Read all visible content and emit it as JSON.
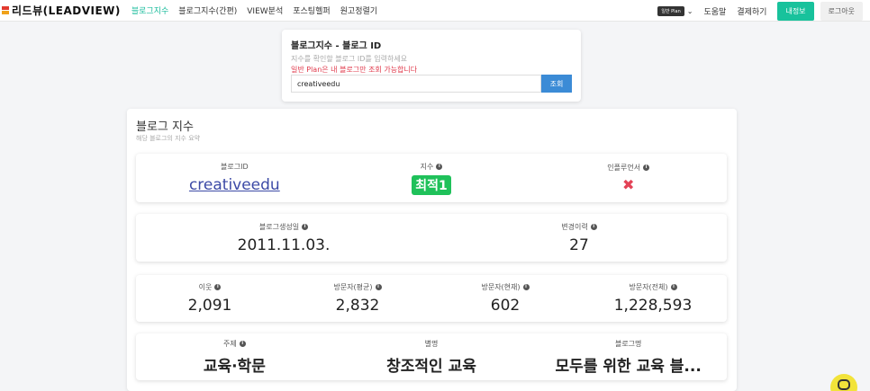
{
  "nav": {
    "logo_text": "리드뷰(LEADVIEW)",
    "items": [
      "블로그지수",
      "블로그지수(간편)",
      "VIEW분석",
      "포스팅헬퍼",
      "원고정렬기"
    ],
    "plan_badge": "일반 Plan",
    "help": "도움말",
    "payment": "결제하기",
    "myinfo": "내정보",
    "logout": "로그아웃"
  },
  "search": {
    "title": "블로그지수 - 블로그 ID",
    "subtitle": "지수를 확인할 블로그 ID를 입력하세요",
    "warning": "일반 Plan은 내 블로그만 조회 가능합니다",
    "value": "creativeedu",
    "button": "조회"
  },
  "main": {
    "title": "블로그 지수",
    "subtitle": "해당 블로그의 지수 요약",
    "row1": {
      "blog_id_label": "블로그ID",
      "blog_id": "creativeedu",
      "index_label": "지수",
      "index_value": "최적1",
      "influencer_label": "인플루언서",
      "influencer_value": "✖"
    },
    "row2": {
      "created_label": "블로그생성일",
      "created": "2011.11.03.",
      "changes_label": "변경이력",
      "changes": "27"
    },
    "row3": {
      "neighbors_label": "이웃",
      "neighbors": "2,091",
      "visitors_avg_label": "방문자(평균)",
      "visitors_avg": "2,832",
      "visitors_now_label": "방문자(현재)",
      "visitors_now": "602",
      "visitors_total_label": "방문자(전체)",
      "visitors_total": "1,228,593"
    },
    "row4": {
      "topic_label": "주제",
      "topic": "교육·학문",
      "alias_label": "별명",
      "alias": "창조적인 교육",
      "blog_name_label": "블로그명",
      "blog_name": "모두를 위한 교육 블..."
    }
  },
  "colors": {
    "accent": "#1abc9c",
    "primary_button": "#3b8bd6",
    "warning": "#e0394b",
    "badge_green": "#1fc15a",
    "link": "#3c4aa6",
    "chat": "#f2e33a"
  }
}
